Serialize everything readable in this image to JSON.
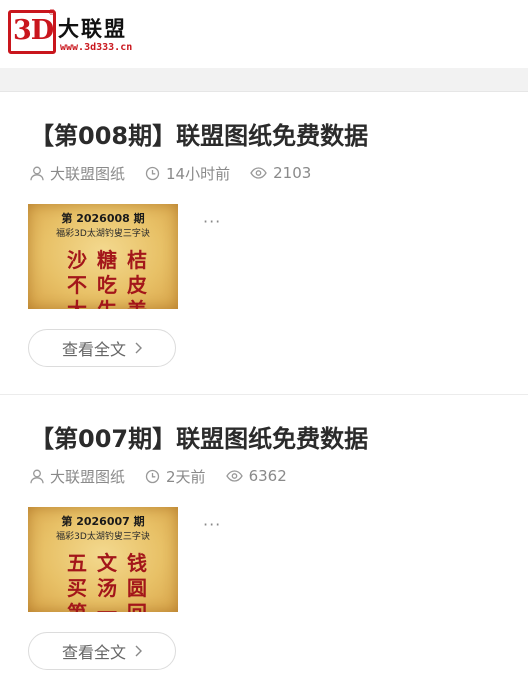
{
  "header": {
    "logo_mark": "3D",
    "logo_reg": "®",
    "logo_name": "大联盟",
    "logo_url": "www.3d333.cn"
  },
  "posts": [
    {
      "title": "【第008期】联盟图纸免费数据",
      "author": "大联盟图纸",
      "time": "14小时前",
      "views": "2103",
      "thumb_issue": "第 2026008 期",
      "thumb_subtitle": "福彩3D太湖钓叟三字诀",
      "thumb_chars": [
        "沙",
        "糖",
        "桔",
        "不",
        "吃",
        "皮",
        "大",
        "生",
        "美"
      ],
      "excerpt": "···",
      "readmore_label": "查看全文"
    },
    {
      "title": "【第007期】联盟图纸免费数据",
      "author": "大联盟图纸",
      "time": "2天前",
      "views": "6362",
      "thumb_issue": "第 2026007 期",
      "thumb_subtitle": "福彩3D太湖钓叟三字诀",
      "thumb_chars": [
        "五",
        "文",
        "钱",
        "买",
        "汤",
        "圆",
        "第",
        "一",
        "回"
      ],
      "excerpt": "···",
      "readmore_label": "查看全文"
    }
  ],
  "colors": {
    "brand_red": "#c9161d",
    "thumb_text_red": "#a3161a",
    "meta_gray": "#8a8a8a"
  },
  "icons": {
    "author": "user-icon",
    "time": "clock-icon",
    "views": "eye-icon",
    "readmore": "chevron-right-icon"
  }
}
